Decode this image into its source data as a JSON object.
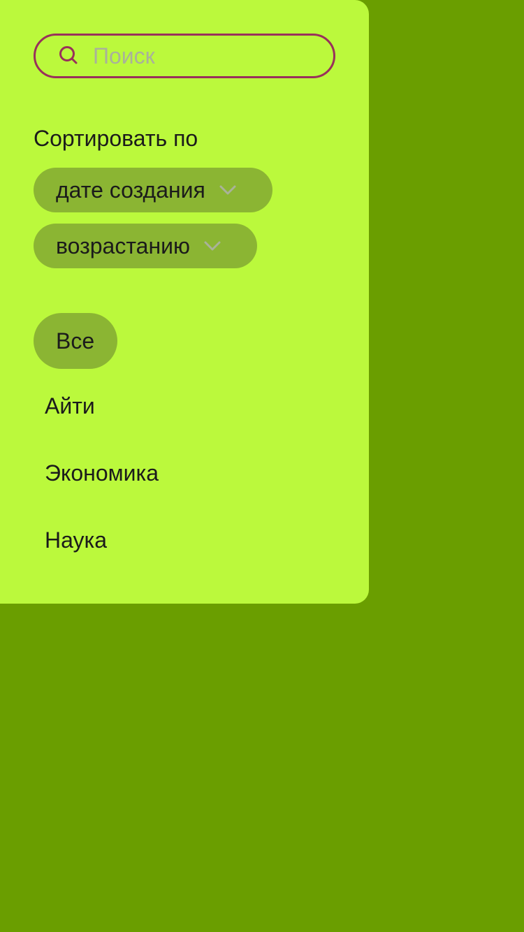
{
  "search": {
    "placeholder": "Поиск",
    "value": ""
  },
  "sort": {
    "title": "Сортировать по",
    "field_label": "дате создания",
    "order_label": "возрастанию"
  },
  "categories": {
    "items": [
      {
        "label": "Все",
        "active": true
      },
      {
        "label": "Айти",
        "active": false
      },
      {
        "label": "Экономика",
        "active": false
      },
      {
        "label": "Наука",
        "active": false
      }
    ]
  },
  "icons": {
    "search": "search-icon",
    "chevron": "chevron-down-icon"
  },
  "colors": {
    "background": "#6a9e00",
    "panel": "#bbf93c",
    "chip": "#8bb533",
    "search_border": "#99305b",
    "chevron": "#a9b29a",
    "text": "#1b1b1b"
  }
}
